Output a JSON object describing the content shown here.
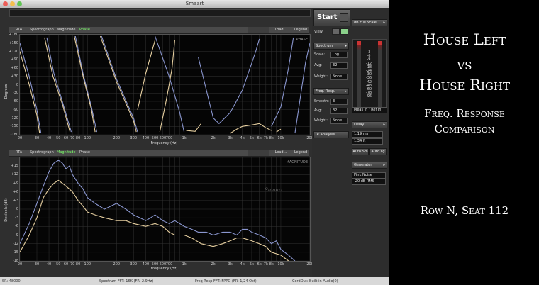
{
  "window": {
    "title": "Smaart",
    "start_label": "Start"
  },
  "top_plot": {
    "tabs": [
      {
        "label": "RTA",
        "active": false
      },
      {
        "label": "Spectrograph",
        "active": false
      },
      {
        "label": "Magnitude",
        "active": false
      },
      {
        "label": "Phase",
        "active": true
      }
    ],
    "buttons": {
      "load": "Load...",
      "legend": "Legend"
    },
    "badge": "PHASE",
    "ylabel": "Degrees",
    "xlabel": "Frequency (Hz)",
    "yticks": [
      "+180",
      "+150",
      "+120",
      "+90",
      "+60",
      "+30",
      "0",
      "-30",
      "-60",
      "-90",
      "-120",
      "-150",
      "-180"
    ],
    "xticks": [
      "20",
      "30",
      "40",
      "50",
      "60",
      "70",
      "80",
      "100",
      "200",
      "300",
      "400",
      "500",
      "600",
      "700",
      "1k",
      "2k",
      "3k",
      "4k",
      "5k",
      "6k",
      "7k",
      "8k",
      "10k",
      "20k"
    ]
  },
  "bottom_plot": {
    "tabs": [
      {
        "label": "RTA",
        "active": false
      },
      {
        "label": "Spectrograph",
        "active": false
      },
      {
        "label": "Magnitude",
        "active": true
      },
      {
        "label": "Phase",
        "active": false
      }
    ],
    "buttons": {
      "load": "Load...",
      "legend": "Legend"
    },
    "badge": "MAGNITUDE",
    "watermark": "Smaart",
    "ylabel": "Decibels (dB)",
    "xlabel": "Frequency (Hz)",
    "yticks": [
      "+15",
      "+12",
      "+9",
      "+6",
      "+3",
      "0",
      "-3",
      "-6",
      "-9",
      "-12",
      "-15",
      "-18"
    ],
    "xticks": [
      "20",
      "30",
      "40",
      "50",
      "60",
      "70",
      "80",
      "100",
      "200",
      "300",
      "400",
      "500",
      "600",
      "700",
      "1k",
      "2k",
      "3k",
      "4k",
      "5k",
      "6k",
      "7k",
      "8k",
      "10k",
      "20k"
    ]
  },
  "colors": {
    "trace_left": "#8a96cf",
    "trace_right": "#e6cfa0",
    "active_tab": "#7cff6a",
    "grid": "#3a3a3a"
  },
  "chart_data": [
    {
      "type": "line",
      "title": "",
      "xlabel": "Frequency (Hz)",
      "ylabel": "Degrees",
      "xscale": "log",
      "xlim": [
        20,
        20000
      ],
      "ylim": [
        -180,
        180
      ],
      "grid": true,
      "series": [
        {
          "color": "#8a96cf",
          "segments": [
            [
              [
                20,
                150
              ],
              [
                25,
                30
              ],
              [
                30,
                -90
              ],
              [
                33,
                -175
              ]
            ],
            [
              [
                38,
                170
              ],
              [
                45,
                40
              ],
              [
                55,
                -60
              ],
              [
                68,
                -170
              ]
            ],
            [
              [
                75,
                175
              ],
              [
                90,
                40
              ],
              [
                110,
                -80
              ],
              [
                125,
                -170
              ]
            ],
            [
              [
                140,
                175
              ],
              [
                200,
                20
              ],
              [
                300,
                -120
              ],
              [
                330,
                -170
              ]
            ],
            [
              [
                500,
                175
              ],
              [
                700,
                30
              ],
              [
                900,
                -100
              ],
              [
                1000,
                -170
              ]
            ],
            [
              [
                1400,
                100
              ],
              [
                1700,
                -20
              ],
              [
                2000,
                -120
              ],
              [
                2300,
                -140
              ],
              [
                3000,
                -100
              ],
              [
                4000,
                -20
              ],
              [
                4800,
                60
              ],
              [
                5500,
                120
              ],
              [
                6000,
                165
              ]
            ],
            [
              [
                8000,
                -150
              ],
              [
                10000,
                -80
              ],
              [
                12000,
                60
              ],
              [
                13500,
                170
              ]
            ],
            [
              [
                14000,
                -175
              ],
              [
                16000,
                -40
              ],
              [
                18000,
                80
              ],
              [
                20000,
                150
              ]
            ]
          ]
        },
        {
          "color": "#e6cfa0",
          "segments": [
            [
              [
                20,
                120
              ],
              [
                25,
                0
              ],
              [
                30,
                -110
              ],
              [
                32,
                -175
              ]
            ],
            [
              [
                36,
                170
              ],
              [
                44,
                30
              ],
              [
                55,
                -70
              ],
              [
                66,
                -170
              ]
            ],
            [
              [
                73,
                175
              ],
              [
                90,
                30
              ],
              [
                110,
                -90
              ],
              [
                120,
                -170
              ]
            ],
            [
              [
                136,
                175
              ],
              [
                200,
                10
              ],
              [
                300,
                -130
              ],
              [
                320,
                -170
              ]
            ],
            [
              [
                330,
                -90
              ],
              [
                400,
                40
              ],
              [
                500,
                160
              ]
            ],
            [
              [
                560,
                -170
              ],
              [
                650,
                -60
              ],
              [
                700,
                0
              ],
              [
                750,
                60
              ],
              [
                800,
                160
              ]
            ],
            [
              [
                1050,
                -165
              ],
              [
                1300,
                -168
              ],
              [
                1500,
                -140
              ]
            ],
            [
              [
                3000,
                -175
              ],
              [
                3500,
                -160
              ],
              [
                4000,
                -150
              ],
              [
                5000,
                -145
              ],
              [
                6000,
                -140
              ],
              [
                7000,
                -155
              ],
              [
                8000,
                -165
              ]
            ],
            [
              [
                9000,
                -170
              ],
              [
                10000,
                -160
              ]
            ]
          ]
        }
      ]
    },
    {
      "type": "line",
      "title": "",
      "xlabel": "Frequency (Hz)",
      "ylabel": "Decibels (dB)",
      "xscale": "log",
      "xlim": [
        20,
        20000
      ],
      "ylim": [
        -18,
        18
      ],
      "grid": true,
      "series": [
        {
          "color": "#8a96cf",
          "points": [
            [
              20,
              -12
            ],
            [
              25,
              -5
            ],
            [
              30,
              2
            ],
            [
              35,
              8
            ],
            [
              40,
              13
            ],
            [
              45,
              16
            ],
            [
              50,
              17
            ],
            [
              55,
              16
            ],
            [
              60,
              14
            ],
            [
              65,
              15
            ],
            [
              70,
              12
            ],
            [
              80,
              9
            ],
            [
              90,
              7
            ],
            [
              100,
              4
            ],
            [
              120,
              2
            ],
            [
              150,
              0
            ],
            [
              200,
              2
            ],
            [
              250,
              0
            ],
            [
              300,
              -2
            ],
            [
              350,
              -3
            ],
            [
              400,
              -4
            ],
            [
              450,
              -3
            ],
            [
              500,
              -2
            ],
            [
              550,
              -3
            ],
            [
              600,
              -4
            ],
            [
              700,
              -5
            ],
            [
              800,
              -4
            ],
            [
              900,
              -5
            ],
            [
              1000,
              -6
            ],
            [
              1200,
              -7
            ],
            [
              1400,
              -8
            ],
            [
              1700,
              -8
            ],
            [
              2000,
              -9
            ],
            [
              2500,
              -8
            ],
            [
              3000,
              -8
            ],
            [
              3500,
              -9
            ],
            [
              4000,
              -7
            ],
            [
              4500,
              -7
            ],
            [
              5000,
              -8
            ],
            [
              6000,
              -9
            ],
            [
              7000,
              -10
            ],
            [
              8000,
              -12
            ],
            [
              9000,
              -11
            ],
            [
              10000,
              -14
            ],
            [
              12000,
              -16
            ],
            [
              14000,
              -18
            ]
          ]
        },
        {
          "color": "#e6cfa0",
          "points": [
            [
              20,
              -15
            ],
            [
              25,
              -9
            ],
            [
              30,
              -3
            ],
            [
              35,
              4
            ],
            [
              40,
              7
            ],
            [
              45,
              9
            ],
            [
              50,
              10
            ],
            [
              55,
              9
            ],
            [
              60,
              8
            ],
            [
              65,
              7
            ],
            [
              70,
              6
            ],
            [
              80,
              3
            ],
            [
              90,
              1
            ],
            [
              100,
              -1
            ],
            [
              120,
              -2
            ],
            [
              150,
              -3
            ],
            [
              200,
              -4
            ],
            [
              250,
              -4
            ],
            [
              300,
              -5
            ],
            [
              400,
              -6
            ],
            [
              500,
              -5
            ],
            [
              600,
              -6
            ],
            [
              700,
              -8
            ],
            [
              800,
              -9
            ],
            [
              1000,
              -9
            ],
            [
              1200,
              -10
            ],
            [
              1500,
              -12
            ],
            [
              2000,
              -13
            ],
            [
              2500,
              -12
            ],
            [
              3000,
              -11
            ],
            [
              3500,
              -10
            ],
            [
              4000,
              -10
            ],
            [
              5000,
              -11
            ],
            [
              6000,
              -12
            ],
            [
              7000,
              -13
            ],
            [
              8000,
              -15
            ],
            [
              10000,
              -16
            ],
            [
              12000,
              -18
            ]
          ]
        }
      ]
    }
  ],
  "panel": {
    "view_label": "View:",
    "db_fullscale": "dB Full Scale",
    "spectrum": {
      "header": "Spectrum",
      "scale_label": "Scale:",
      "scale_value": "Log",
      "avg_label": "Avg:",
      "avg_value": "32",
      "weight_label": "Weight:",
      "weight_value": "None"
    },
    "freq_resp": {
      "header": "Freq. Resp.",
      "smooth_label": "Smooth:",
      "smooth_value": "3",
      "avg_label": "Avg:",
      "avg_value": "32",
      "weight_label": "Weight:",
      "weight_value": "None"
    },
    "ir_analysis": "IR Analysis",
    "meter_scale": [
      "-3",
      "-6",
      "-9",
      "-12",
      "-18",
      "-24",
      "-30",
      "-36",
      "-42",
      "-48",
      "-60",
      "-78",
      "-96"
    ],
    "meter_mode": "Meas In / Ref In",
    "delay": {
      "header": "Delay",
      "ms": "1.19 ms",
      "ft": "1.34 ft",
      "auto_sm": "Auto Sm",
      "auto_lg": "Auto Lg"
    },
    "generator": {
      "header": "Generator",
      "noise": "Pink Noise",
      "level": "-20 dB  RMS"
    }
  },
  "status": {
    "sr": "SR: 48000",
    "spectrum_fft": "Spectrum FFT: 16K (FR: 2.9Hz)",
    "freq_resp_fft": "Freq Resp FFT: FPPO (FR: 1/24 Oct)",
    "cordout": "CordOut: Built-in Audio(0)"
  },
  "slide": {
    "line1": "House Left",
    "line2": "vs",
    "line3": "House Right",
    "subtitle1": "Freq. Response",
    "subtitle2": "Comparison",
    "seat": "Row N, Seat 112"
  }
}
